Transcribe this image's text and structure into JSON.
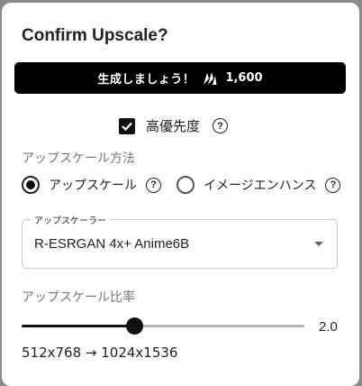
{
  "dialog": {
    "title": "Confirm Upscale?"
  },
  "generate_button": {
    "label": "生成しましょう！",
    "cost": "1,600",
    "icon": "anlas-icon"
  },
  "priority": {
    "label": "高優先度",
    "checked": true
  },
  "method": {
    "section_label": "アップスケール方法",
    "options": [
      {
        "label": "アップスケール",
        "selected": true
      },
      {
        "label": "イメージエンハンス",
        "selected": false
      }
    ]
  },
  "upscaler": {
    "legend": "アップスケーラー",
    "value": "R-ESRGAN 4x+ Anime6B"
  },
  "ratio": {
    "section_label": "アップスケール比率",
    "value": "2.0",
    "fraction": 0.4
  },
  "resolution": {
    "text": "512x768 → 1024x1536"
  },
  "colors": {
    "accent": "#000000",
    "track": "#b5b5b5",
    "muted_text": "#777777"
  }
}
